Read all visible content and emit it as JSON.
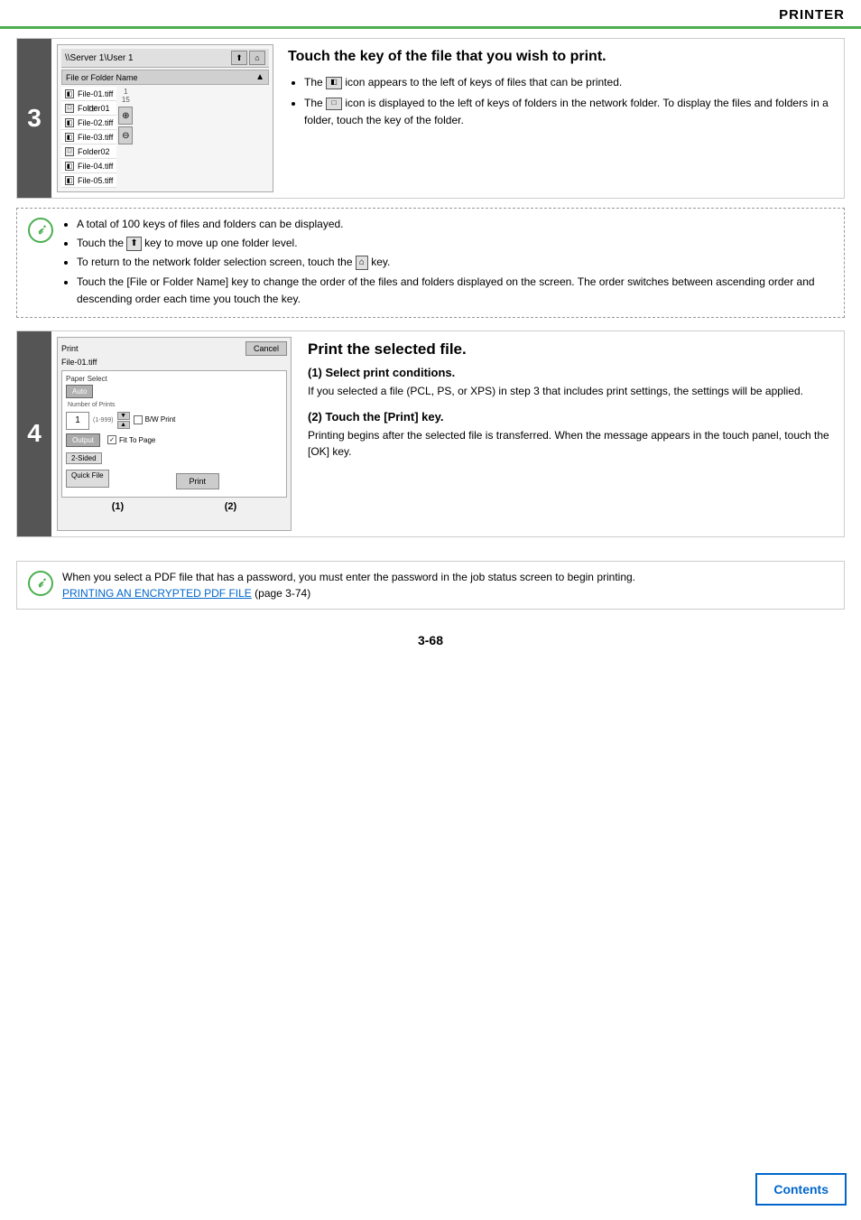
{
  "header": {
    "title": "PRINTER"
  },
  "step3": {
    "number": "3",
    "ui": {
      "path": "\\\\Server 1\\User 1",
      "sort_btn1": "↑",
      "sort_btn2": "↓",
      "column_header": "File or Folder Name",
      "sort_arrow": "▲",
      "files": [
        {
          "name": "File-01.tiff",
          "type": "file"
        },
        {
          "name": "Folder01",
          "type": "folder"
        },
        {
          "name": "File-02.tiff",
          "type": "file"
        },
        {
          "name": "File-03.tiff",
          "type": "file"
        },
        {
          "name": "Folder02",
          "type": "folder"
        },
        {
          "name": "File-04.tiff",
          "type": "file"
        },
        {
          "name": "File-05.tiff",
          "type": "file"
        }
      ],
      "page_indicator": "1\n15",
      "scroll_up": "⊕",
      "scroll_down": "⊖"
    },
    "title": "Touch the key of the file that you wish to print.",
    "bullets": [
      "The    icon appears to the left of keys of files that can be printed.",
      "The    icon is displayed to the left of keys of folders in the network folder. To display the files and folders in a folder, touch the key of the folder."
    ]
  },
  "note3": {
    "bullets": [
      "A total of 100 keys of files and folders can be displayed.",
      "Touch the      key to move up one folder level.",
      "To return to the network folder selection screen, touch the      key.",
      "Touch the [File or Folder Name] key to change the order of the files and folders displayed on the screen. The order switches between ascending order and descending order each time you touch the key."
    ]
  },
  "step4": {
    "number": "4",
    "ui": {
      "print_label": "Print",
      "cancel_label": "Cancel",
      "filename": "File-01.tiff",
      "paper_select_label": "Paper Select",
      "auto_label": "Auto",
      "num_prints_label": "Number of Prints",
      "quantity": "1",
      "quantity_hint": "(1-999)",
      "bw_print_label": "B/W Print",
      "output_label": "Output",
      "fit_label": "Fit To Page",
      "twosided_label": "2-Sided",
      "quickfile_label": "Quick File",
      "print_btn": "Print",
      "callout1": "(1)",
      "callout2": "(2)"
    },
    "title": "Print the selected file.",
    "sub1": {
      "heading": "(1)  Select print conditions.",
      "text": "If you selected a file (PCL, PS, or XPS) in step 3 that includes print settings, the settings will be applied."
    },
    "sub2": {
      "heading": "(2)  Touch the [Print] key.",
      "text": "Printing begins after the selected file is transferred. When the message appears in the touch panel, touch the [OK] key."
    }
  },
  "bottom_note": {
    "text": "When you select a PDF file that has a password, you must enter the password in the job status screen to begin printing.",
    "link_text": "PRINTING AN ENCRYPTED PDF FILE",
    "link_suffix": " (page 3-74)"
  },
  "footer": {
    "page": "3-68",
    "contents_btn": "Contents"
  }
}
